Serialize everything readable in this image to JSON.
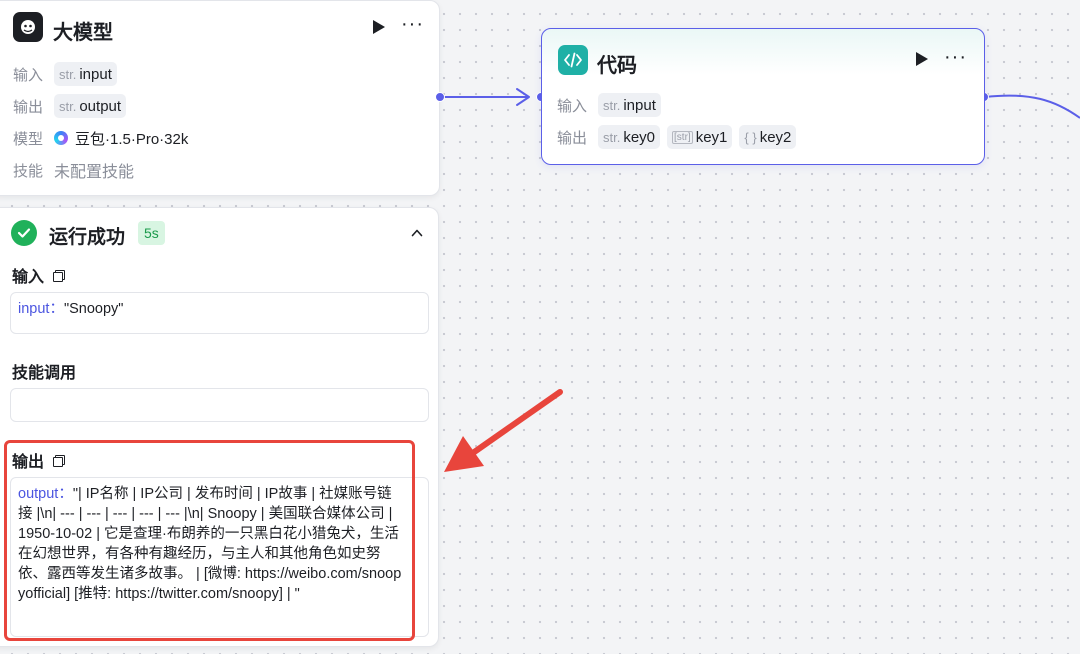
{
  "llm_node": {
    "title": "大模型",
    "input_label": "输入",
    "input_type": "str.",
    "input_name": "input",
    "output_label": "输出",
    "output_type": "str.",
    "output_name": "output",
    "model_label": "模型",
    "model_name": "豆包·1.5·Pro·32k",
    "skill_label": "技能",
    "skill_value": "未配置技能"
  },
  "code_node": {
    "title": "代码",
    "input_label": "输入",
    "input_type": "str.",
    "input_name": "input",
    "output_label": "输出",
    "outputs": [
      {
        "type": "str.",
        "name": "key0"
      },
      {
        "type": "[str]",
        "name": "key1"
      },
      {
        "type": "{ }",
        "name": "key2"
      }
    ]
  },
  "result_panel": {
    "status": "运行成功",
    "duration": "5s",
    "input_title": "输入",
    "input_key": "input：",
    "input_value": "\"Snoopy\"",
    "skill_call_title": "技能调用",
    "output_title": "输出",
    "output_key": "output：",
    "output_value": "\"| IP名称 | IP公司 | 发布时间 | IP故事 | 社媒账号链接 |\\n| --- | --- | --- | --- | --- |\\n| Snoopy | 美国联合媒体公司 | 1950-10-02 | 它是查理·布朗养的一只黑白花小猎兔犬，生活在幻想世界，有各种有趣经历，与主人和其他角色如史努依、露西等发生诸多故事。 | [微博: https://weibo.com/snoopyofficial] [推特: https://twitter.com/snoopy] | \""
  },
  "colors": {
    "accent": "#5b5fe8",
    "success": "#20b15a",
    "highlight": "#e8453c",
    "code_icon": "#1fb0a6"
  }
}
